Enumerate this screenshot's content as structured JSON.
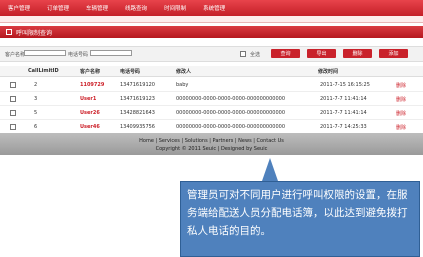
{
  "nav": {
    "items": [
      "客户管理",
      "订单管理",
      "车辆管理",
      "线路查询",
      "时间限制",
      "系统管理"
    ]
  },
  "page": {
    "title": "呼叫限制查询"
  },
  "search": {
    "customer_label": "客户名称",
    "phone_label": "电话号码",
    "all_label": "全选",
    "buttons": [
      "查询",
      "导出",
      "删除",
      "添加"
    ]
  },
  "table": {
    "headers": [
      "CallLimitID",
      "客户名称",
      "电话号码",
      "修改人",
      "修改时间"
    ],
    "rows": [
      {
        "id": "2",
        "name": "1109729",
        "phone": "13471619120",
        "modifier": "baby",
        "time": "2011-7-15 16:15:25",
        "action": "删除"
      },
      {
        "id": "3",
        "name": "User1",
        "phone": "13471619123",
        "modifier": "00000000-0000-0000-0000-000000000000",
        "time": "2011-7-7 11:41:14",
        "action": "删除"
      },
      {
        "id": "5",
        "name": "User26",
        "phone": "13428821643",
        "modifier": "00000000-0000-0000-0000-000000000000",
        "time": "2011-7-7 11:41:14",
        "action": "删除"
      },
      {
        "id": "6",
        "name": "User46",
        "phone": "13409935756",
        "modifier": "00000000-0000-0000-0000-000000000000",
        "time": "2011-7-7 14:25:33",
        "action": "删除"
      }
    ]
  },
  "footer": {
    "links": "Home | Services | Solutions | Partners | News | Contact Us",
    "copyright": "Copyright © 2011 Seuic | Designed by Seuic"
  },
  "callout": {
    "text": "管理员可对不同用户进行呼叫权限的设置，在服务端给配送人员分配电话簿，以此达到避免拨打私人电话的目的。"
  },
  "colors": {
    "accent": "#c9222b",
    "callout": "#4f81bd"
  }
}
